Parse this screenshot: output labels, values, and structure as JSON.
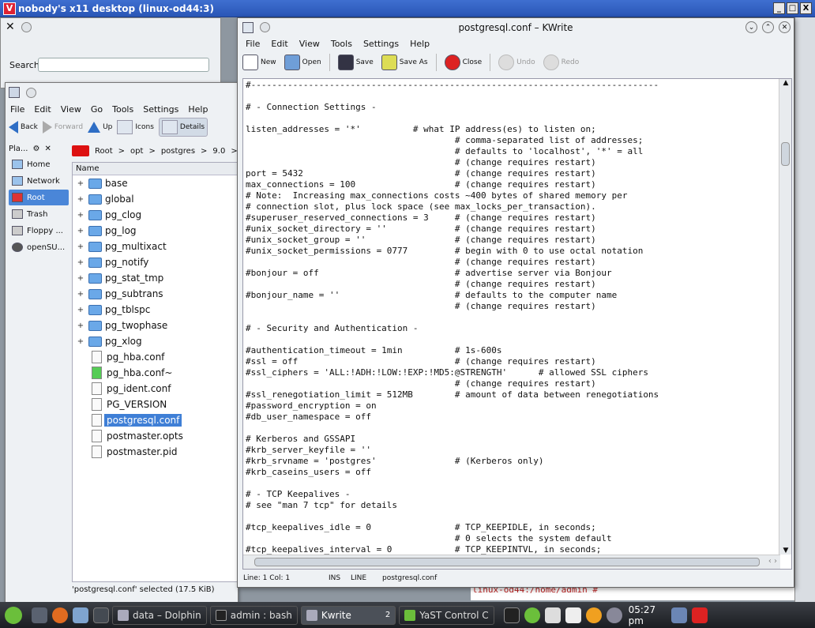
{
  "vnc": {
    "title": "nobody's x11 desktop (linux-od44:3)",
    "logo": "V",
    "min": "_",
    "max": "□",
    "close": "X"
  },
  "search_window": {
    "search_label": "Search",
    "search_value": ""
  },
  "dolphin": {
    "menu": [
      "File",
      "Edit",
      "View",
      "Go",
      "Tools",
      "Settings",
      "Help"
    ],
    "toolbar": {
      "back": "Back",
      "forward": "Forward",
      "up": "Up",
      "icons": "Icons",
      "details": "Details"
    },
    "places_header": "Pla...",
    "places": [
      {
        "label": "Home",
        "icon": "home-icon"
      },
      {
        "label": "Network",
        "icon": "network-icon"
      },
      {
        "label": "Root",
        "icon": "root-icon",
        "selected": true
      },
      {
        "label": "Trash",
        "icon": "trash-icon"
      },
      {
        "label": "Floppy ...",
        "icon": "floppy-icon"
      },
      {
        "label": "openSU...",
        "icon": "disc-icon"
      }
    ],
    "breadcrumb": [
      "Root",
      ">",
      "opt",
      ">",
      "postgres",
      ">",
      "9.0",
      ">"
    ],
    "column_header": "Name",
    "files": [
      {
        "name": "base",
        "type": "folder"
      },
      {
        "name": "global",
        "type": "folder"
      },
      {
        "name": "pg_clog",
        "type": "folder"
      },
      {
        "name": "pg_log",
        "type": "folder"
      },
      {
        "name": "pg_multixact",
        "type": "folder"
      },
      {
        "name": "pg_notify",
        "type": "folder"
      },
      {
        "name": "pg_stat_tmp",
        "type": "folder"
      },
      {
        "name": "pg_subtrans",
        "type": "folder"
      },
      {
        "name": "pg_tblspc",
        "type": "folder"
      },
      {
        "name": "pg_twophase",
        "type": "folder"
      },
      {
        "name": "pg_xlog",
        "type": "folder"
      },
      {
        "name": "pg_hba.conf",
        "type": "file"
      },
      {
        "name": "pg_hba.conf~",
        "type": "file-backup"
      },
      {
        "name": "pg_ident.conf",
        "type": "file"
      },
      {
        "name": "PG_VERSION",
        "type": "file"
      },
      {
        "name": "postgresql.conf",
        "type": "file",
        "selected": true
      },
      {
        "name": "postmaster.opts",
        "type": "file"
      },
      {
        "name": "postmaster.pid",
        "type": "file"
      }
    ],
    "status": "'postgresql.conf' selected (17.5 KiB)"
  },
  "kwrite": {
    "title": "postgresql.conf – KWrite",
    "menu": [
      "File",
      "Edit",
      "View",
      "Tools",
      "Settings",
      "Help"
    ],
    "toolbar": {
      "new": "New",
      "open": "Open",
      "save": "Save",
      "save_as": "Save As",
      "close": "Close",
      "undo": "Undo",
      "redo": "Redo"
    },
    "content": [
      "#------------------------------------------------------------------------------",
      "",
      "# - Connection Settings -",
      "",
      "listen_addresses = '*'          # what IP address(es) to listen on;",
      "                                        # comma-separated list of addresses;",
      "                                        # defaults to 'localhost', '*' = all",
      "                                        # (change requires restart)",
      "port = 5432                             # (change requires restart)",
      "max_connections = 100                   # (change requires restart)",
      "# Note:  Increasing max_connections costs ~400 bytes of shared memory per",
      "# connection slot, plus lock space (see max_locks_per_transaction).",
      "#superuser_reserved_connections = 3     # (change requires restart)",
      "#unix_socket_directory = ''             # (change requires restart)",
      "#unix_socket_group = ''                 # (change requires restart)",
      "#unix_socket_permissions = 0777         # begin with 0 to use octal notation",
      "                                        # (change requires restart)",
      "#bonjour = off                          # advertise server via Bonjour",
      "                                        # (change requires restart)",
      "#bonjour_name = ''                      # defaults to the computer name",
      "                                        # (change requires restart)",
      "",
      "# - Security and Authentication -",
      "",
      "#authentication_timeout = 1min          # 1s-600s",
      "#ssl = off                              # (change requires restart)",
      "#ssl_ciphers = 'ALL:!ADH:!LOW:!EXP:!MD5:@STRENGTH'      # allowed SSL ciphers",
      "                                        # (change requires restart)",
      "#ssl_renegotiation_limit = 512MB        # amount of data between renegotiations",
      "#password_encryption = on",
      "#db_user_namespace = off",
      "",
      "# Kerberos and GSSAPI",
      "#krb_server_keyfile = ''",
      "#krb_srvname = 'postgres'               # (Kerberos only)",
      "#krb_caseins_users = off",
      "",
      "# - TCP Keepalives -",
      "# see \"man 7 tcp\" for details",
      "",
      "#tcp_keepalives_idle = 0                # TCP_KEEPIDLE, in seconds;",
      "                                        # 0 selects the system default",
      "#tcp_keepalives_interval = 0            # TCP_KEEPINTVL, in seconds;"
    ],
    "status": {
      "position": "Line: 1 Col: 1",
      "mode": "INS",
      "select": "LINE",
      "filename": "postgresql.conf"
    }
  },
  "konsole": {
    "prompt": "linux-od44:/home/admin # "
  },
  "taskbar": {
    "tasks": [
      {
        "label": "data – Dolphin",
        "active": false
      },
      {
        "label": "admin : bash",
        "active": false
      },
      {
        "label": "Kwrite",
        "active": true,
        "count": "2"
      },
      {
        "label": "YaST Control C",
        "active": false
      }
    ],
    "clock": "05:27 pm"
  }
}
